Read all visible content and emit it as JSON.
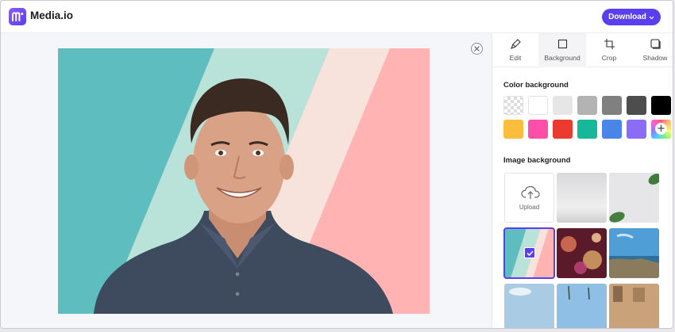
{
  "app": {
    "brand_name": "Media.io",
    "logo_letter": "m",
    "download_label": "Download"
  },
  "tabs": [
    {
      "label": "Edit",
      "icon": "brush-icon"
    },
    {
      "label": "Background",
      "icon": "background-icon"
    },
    {
      "label": "Crop",
      "icon": "crop-icon"
    },
    {
      "label": "Shadow",
      "icon": "shadow-icon"
    }
  ],
  "active_tab": "Background",
  "color_background": {
    "title": "Color background",
    "swatches": [
      "transparent",
      "#ffffff",
      "#e6e6e6",
      "#b3b3b3",
      "#808080",
      "#4d4d4d",
      "#000000",
      "#fbbd3c",
      "#ff4fa8",
      "#eb3b30",
      "#17b79a",
      "#4a86e8",
      "#8b6cf6",
      "custom"
    ]
  },
  "image_background": {
    "title": "Image background",
    "upload_label": "Upload",
    "items": [
      "studio-grey-backdrop",
      "leaf-shadows-backdrop",
      "pastel-stripes-backdrop",
      "bokeh-lights-backdrop",
      "seaside-cliffs-backdrop",
      "sky-backdrop",
      "palm-city-backdrop",
      "old-town-backdrop"
    ],
    "selected": "pastel-stripes-backdrop"
  },
  "colors": {
    "accent": "#5a3ff0",
    "stripe_teal": "#5dbdbf",
    "stripe_mint": "#b9e2d9",
    "stripe_cream": "#f8e3dc",
    "stripe_pink": "#ffb3b3"
  }
}
